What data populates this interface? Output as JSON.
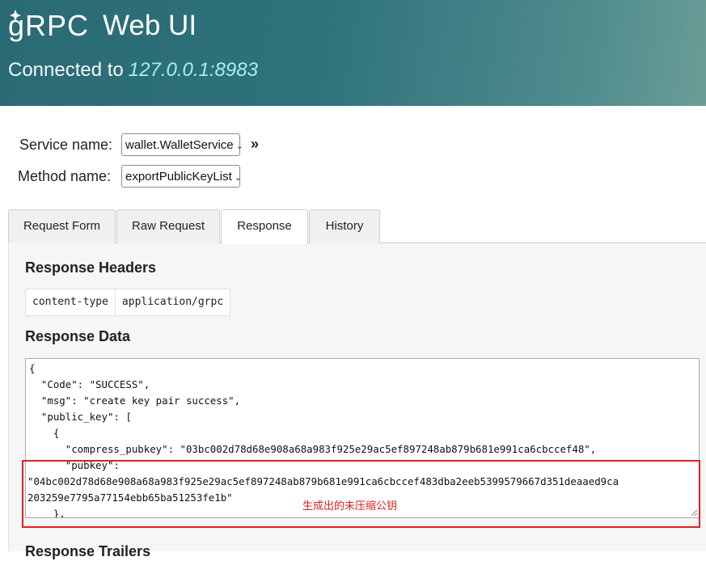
{
  "header": {
    "logo_text": "gRPC",
    "title": "Web UI",
    "connected_label": "Connected to",
    "address": "127.0.0.1:8983"
  },
  "form": {
    "service_label": "Service name:",
    "service_value": "wallet.WalletService",
    "method_label": "Method name:",
    "method_value": "exportPublicKeyList",
    "expand_glyph": "»"
  },
  "tabs": [
    {
      "label": "Request Form",
      "active": false
    },
    {
      "label": "Raw Request",
      "active": false
    },
    {
      "label": "Response",
      "active": true
    },
    {
      "label": "History",
      "active": false
    }
  ],
  "response": {
    "headers_title": "Response Headers",
    "headers": [
      {
        "name": "content-type",
        "value": "application/grpc"
      }
    ],
    "data_title": "Response Data",
    "data_lines": [
      "{",
      "  \"Code\": \"SUCCESS\",",
      "  \"msg\": \"create key pair success\",",
      "  \"public_key\": [",
      "    {",
      "      \"compress_pubkey\": \"03bc002d78d68e908a68a983f925e29ac5ef897248ab879b681e991ca6cbccef48\",",
      "      \"pubkey\":",
      "\"04bc002d78d68e908a68a983f925e29ac5ef897248ab879b681e991ca6cbccef483dba2eeb5399579667d351deaaed9ca",
      "203259e7795a77154ebb65ba51253fe1b\"",
      "    },"
    ],
    "trailers_title": "Response Trailers"
  },
  "annotation": {
    "text": "生成出的未压缩公钥",
    "color": "#e02020"
  }
}
